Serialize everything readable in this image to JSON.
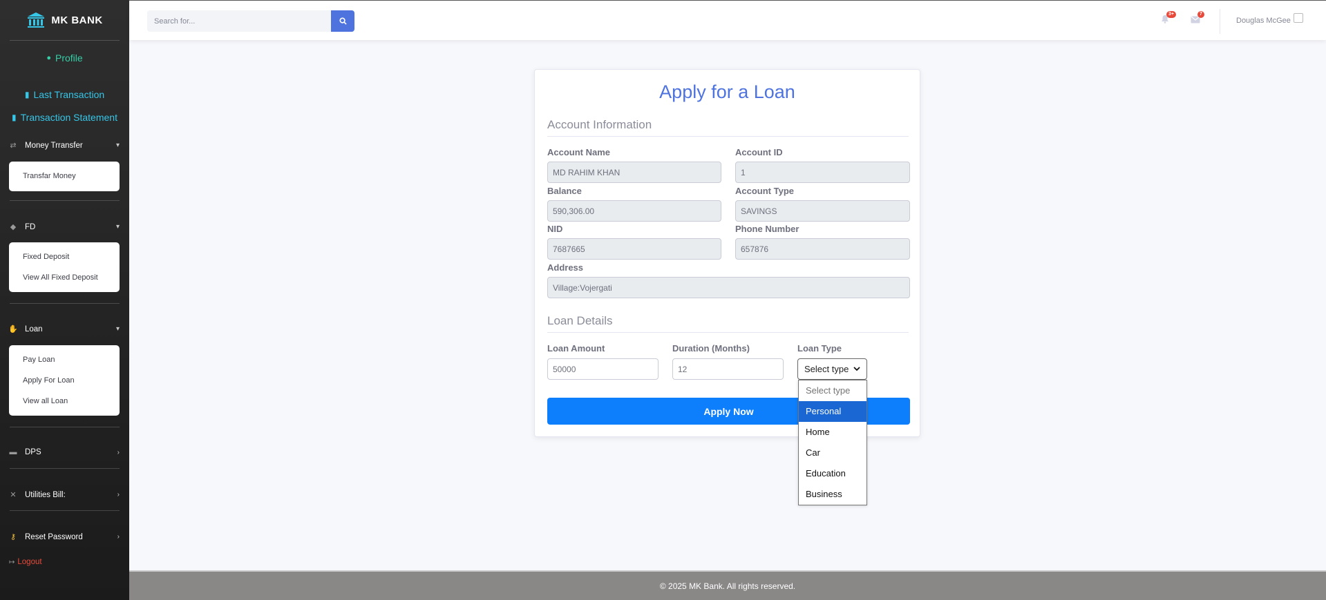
{
  "brand": {
    "name": "MK BANK"
  },
  "sidebar": {
    "profile": "Profile",
    "last_transaction": "Last Transaction",
    "transaction_statement": "Transaction Statement",
    "money_transfer": {
      "label": "Money Trransfer",
      "items": [
        "Transfar Money"
      ]
    },
    "fd": {
      "label": "FD",
      "items": [
        "Fixed Deposit",
        "View All Fixed Deposit"
      ]
    },
    "loan": {
      "label": "Loan",
      "items": [
        "Pay Loan",
        "Apply For Loan",
        "View all Loan"
      ]
    },
    "dps": {
      "label": "DPS"
    },
    "utilities": {
      "label": "Utilities Bill:"
    },
    "reset_password": {
      "label": "Reset Password"
    },
    "logout": "Logout"
  },
  "topbar": {
    "search_placeholder": "Search for...",
    "alerts_badge": "3+",
    "messages_badge": "7",
    "user_name": "Douglas McGee"
  },
  "form": {
    "title": "Apply for a Loan",
    "account_section": "Account Information",
    "account_name_label": "Account Name",
    "account_name": "MD RAHIM KHAN",
    "account_id_label": "Account ID",
    "account_id": "1",
    "balance_label": "Balance",
    "balance": "590,306.00",
    "account_type_label": "Account Type",
    "account_type": "SAVINGS",
    "nid_label": "NID",
    "nid": "7687665",
    "phone_label": "Phone Number",
    "phone": "657876",
    "address_label": "Address",
    "address": "Village:Vojergati",
    "loan_section": "Loan Details",
    "loan_amount_label": "Loan Amount",
    "loan_amount": "50000",
    "duration_label": "Duration (Months)",
    "duration": "12",
    "loan_type_label": "Loan Type",
    "loan_type_value": "Select type",
    "loan_type_options": [
      "Select type",
      "Personal",
      "Home",
      "Car",
      "Education",
      "Business"
    ],
    "highlighted_option": "Personal",
    "apply_button": "Apply Now"
  },
  "footer": {
    "text": "© 2025 MK Bank. All rights reserved."
  },
  "colors": {
    "primary": "#4e73df",
    "apply": "#0d7efc",
    "profile": "#33d0a8",
    "link": "#36c6e8",
    "logout": "#e74a3b"
  }
}
